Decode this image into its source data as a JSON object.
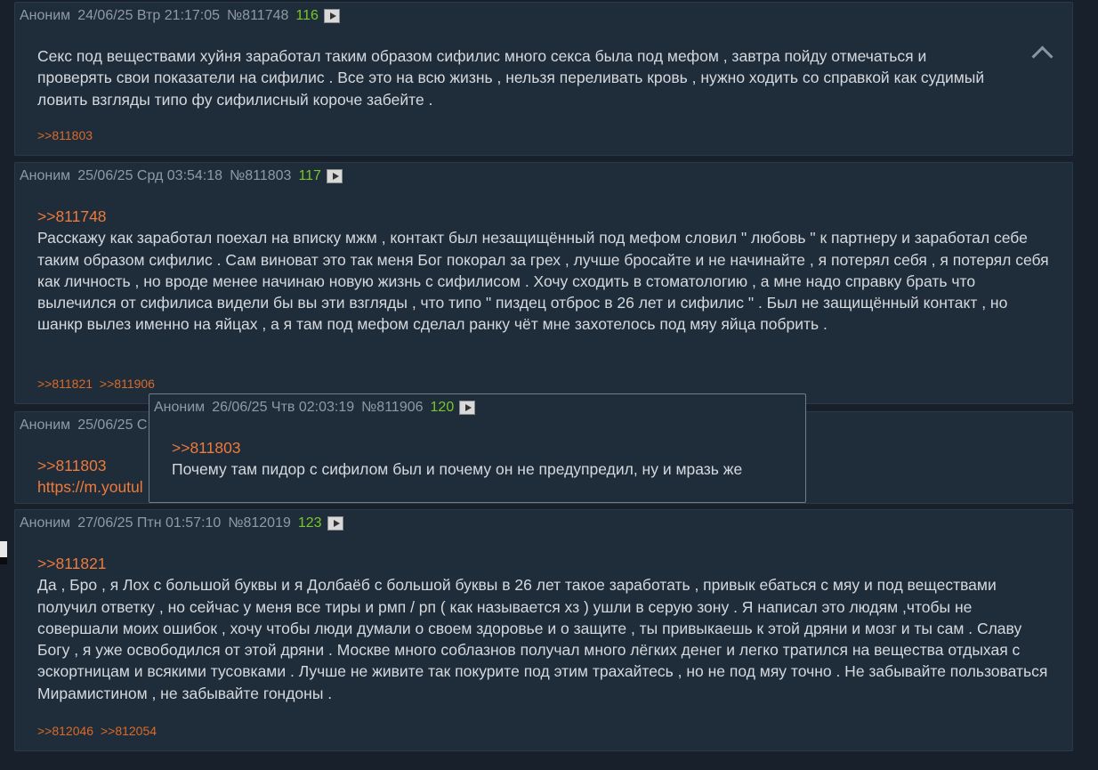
{
  "posts": [
    {
      "author": "Аноним",
      "date": "24/06/25 Втр 21:17:05",
      "num": "№811748",
      "count": "116",
      "quote": "",
      "text": "Секс под веществами хуйня заработал таким образом сифилис много секса была под мефом , завтра пойду отмечаться и проверять свои показатели на сифилис . Все это на всю жизнь , нельзя переливать кровь , нужно ходить со справкой как судимый ловить взгляды типо фу сифилисный короче забейте .",
      "replies": [
        ">>811803"
      ]
    },
    {
      "author": "Аноним",
      "date": "25/06/25 Срд 03:54:18",
      "num": "№811803",
      "count": "117",
      "quote": ">>811748",
      "text": "Расскажу как заработал поехал на вписку мжм , контакт был незащищённый под мефом словил \" любовь \" к партнеру и заработал себе таким образом сифилис . Сам виноват это так меня Бог покорал за грех , лучше бросайте и не начинайте , я потерял себя , я потерял себя как личность , но вроде менее начинаю новую жизнь с сифилисом . Хочу сходить в стоматологию , а мне надо справку брать что вылечился от сифилиса видели бы вы эти взгляды , что типо \" пиздец отброс в 26 лет и сифилис \" . Был не защищённый контакт , но шанкр вылез именно на яйцах , а я там под мефом сделал ранку чёт мне захотелось под мяу яйца побрить .",
      "replies": [
        ">>811821",
        ">>811906"
      ]
    },
    {
      "author": "Аноним",
      "date": "25/06/25 С",
      "quote": ">>811803",
      "link": "https://m.youtul"
    },
    {
      "author": "Аноним",
      "date": "27/06/25 Птн 01:57:10",
      "num": "№812019",
      "count": "123",
      "quote": ">>811821",
      "text": "Да , Бро , я Лох с большой буквы и я Долбаёб с большой буквы в 26 лет такое заработать , привык ебаться с мяу и под веществами получил ответку , но сейчас у меня все тиры и рмп / рп ( как называется хз ) ушли в серую зону . Я написал это людям ,чтобы не совершали моих ошибок , хочу чтобы люди думали о своем здоровье и о защите , ты привыкаешь к этой дряни и мозг и ты сам . Славу Богу , я уже освободился от этой дряни . Москве много соблазнов получал много лёгких денег и легко тратился на вещества отдыхая с эскортницам и всякими тусовками . Лучше не живите так покурите под этим трахайтесь , но не под мяу точно . Не забывайте пользоваться Мирамистином , не забывайте гондоны .",
      "replies": [
        ">>812046",
        ">>812054"
      ]
    }
  ],
  "popup": {
    "author": "Аноним",
    "date": "26/06/25 Чтв 02:03:19",
    "num": "№811906",
    "count": "120",
    "quote": ">>811803",
    "text": "Почему там пидор с сифилом был и почему он не предупредил, ну и мразь же"
  },
  "colors": {
    "background": "#18212b",
    "post": "#1f2c39",
    "count_green": "#78c72a",
    "link_orange": "#ef7a3a"
  }
}
